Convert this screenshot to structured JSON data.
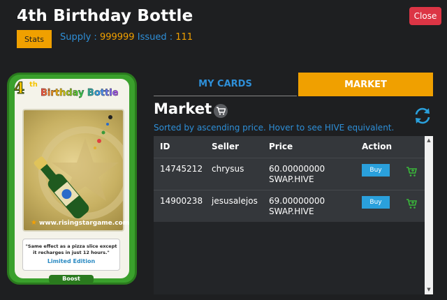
{
  "header": {
    "title": "4th Birthday Bottle",
    "close_label": "Close",
    "stats_label": "Stats",
    "supply_label": "Supply :",
    "supply_value": "999999",
    "issued_label": "Issued :",
    "issued_value": "111"
  },
  "card": {
    "number": "4",
    "ordinal": "th",
    "name": "Birthday Bottle",
    "url": "www.risingstargame.com",
    "description": "\"Same effect as a pizza slice except it recharges in just 12 hours.\"",
    "edition": "Limited Edition",
    "type": "Boost"
  },
  "tabs": [
    {
      "label": "MY CARDS",
      "active": false
    },
    {
      "label": "MARKET",
      "active": true
    }
  ],
  "market": {
    "title": "Market",
    "sorted_text": "Sorted by ascending price. Hover to see HIVE equivalent.",
    "columns": [
      "ID",
      "Seller",
      "Price",
      "Action"
    ],
    "rows": [
      {
        "id": "14745212",
        "seller": "chrysus",
        "price": "60.00000000",
        "currency": "SWAP.HIVE",
        "buy_label": "Buy"
      },
      {
        "id": "14900238",
        "seller": "jesusalejos",
        "price": "69.00000000",
        "currency": "SWAP.HIVE",
        "buy_label": "Buy"
      }
    ]
  },
  "colors": {
    "accent_orange": "#f0a000",
    "link_blue": "#2e8fd8",
    "close_red": "#dc3545",
    "buy_blue": "#2aa0dc",
    "cart_green": "#3ab83a"
  }
}
